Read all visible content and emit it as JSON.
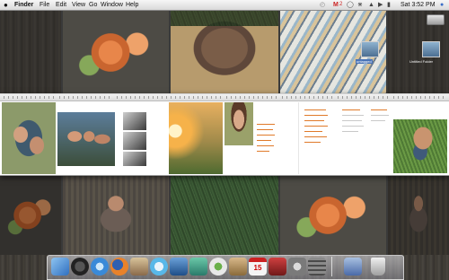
{
  "menubar": {
    "apple_icon": "apple-logo-icon",
    "items": [
      "Finder",
      "File",
      "Edit",
      "View",
      "Go",
      "Window",
      "Help"
    ],
    "clock": "Sat 3:52 PM",
    "mail_badge": "2",
    "status_icons": [
      "gmail-notifier-icon",
      "time-machine-icon",
      "bluetooth-icon",
      "wifi-icon",
      "volume-icon"
    ]
  },
  "desktop": {
    "icons": [
      {
        "label": "untagged",
        "icon": "folder-icon"
      },
      {
        "label": "Untitled Folder",
        "icon": "folder-icon"
      }
    ]
  },
  "dock": {
    "apps": [
      {
        "name": "finder-icon",
        "color": "#3f8fe0"
      },
      {
        "name": "dashboard-icon",
        "color": "#3d3d3d"
      },
      {
        "name": "safari-icon",
        "color": "#5aa3e8"
      },
      {
        "name": "firefox-icon",
        "color": "#e8822b"
      },
      {
        "name": "preview-icon",
        "color": "#8a6a4a"
      },
      {
        "name": "itunes-icon",
        "color": "#58b8e8"
      },
      {
        "name": "photoshop-icon",
        "color": "#2a6aa8"
      },
      {
        "name": "dreamweaver-icon",
        "color": "#3aa08a"
      },
      {
        "name": "contribute-icon",
        "color": "#d4d4d4"
      },
      {
        "name": "address-book-icon",
        "color": "#b08a5a"
      },
      {
        "name": "ical-icon",
        "color": "#f0f0f0"
      },
      {
        "name": "photo-booth-icon",
        "color": "#a02a2a"
      },
      {
        "name": "system-preferences-icon",
        "color": "#9a9a9a"
      },
      {
        "name": "calculator-icon",
        "color": "#6a6a6a"
      },
      {
        "name": "downloads-stack-icon",
        "color": "#5a7ab0"
      },
      {
        "name": "trash-icon",
        "color": "#c8c8c8"
      }
    ],
    "ical_date": "15"
  },
  "colors": {
    "accent_orange": "#e07a2a",
    "menubar": "#e6e6e6"
  }
}
